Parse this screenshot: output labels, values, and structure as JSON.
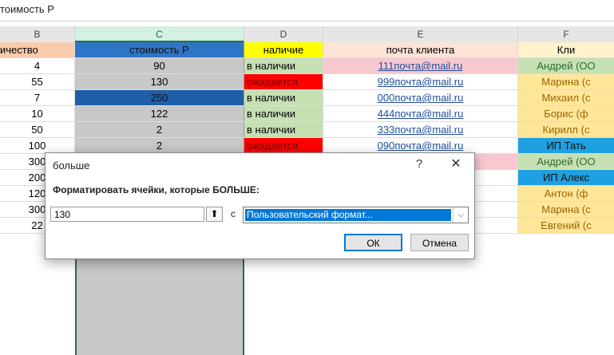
{
  "formula_bar": {
    "text": "тоимость Р"
  },
  "columns": {
    "b": "B",
    "c": "C",
    "d": "D",
    "e": "E",
    "f": "F"
  },
  "header_row": {
    "b": "ичество",
    "c": "стоимость Р",
    "d": "наличие",
    "e": "почта клиента",
    "f": "Кли"
  },
  "rows": [
    {
      "b": "4",
      "c": "90",
      "d": "в наличии",
      "e": "111почта@mail.ru",
      "f": "Андрей (ОО"
    },
    {
      "b": "55",
      "c": "130",
      "d": "ожидается",
      "e": "999почта@mail.ru",
      "f": "Марина (с"
    },
    {
      "b": "7",
      "c": "250",
      "d": "в наличии",
      "e": "000почта@mail.ru",
      "f": "Михаил (с"
    },
    {
      "b": "10",
      "c": "122",
      "d": "в наличии",
      "e": "444почта@mail.ru",
      "f": "Борис (ф"
    },
    {
      "b": "50",
      "c": "2",
      "d": "в наличии",
      "e": "333почта@mail.ru",
      "f": "Кирилл (с"
    },
    {
      "b": "100",
      "c": "2",
      "d": "ожидается",
      "e": "090почта@mail.ru",
      "f": "ИП Тать"
    },
    {
      "b": "300",
      "c": "",
      "d": "",
      "e": "",
      "f": "Андрей (ОО"
    },
    {
      "b": "200",
      "c": "",
      "d": "",
      "e": "",
      "f": "ИП Алекс"
    },
    {
      "b": "120",
      "c": "",
      "d": "",
      "e": "",
      "f": "Антон (ф"
    },
    {
      "b": "300",
      "c": "",
      "d": "",
      "e": "",
      "f": "Марина (с"
    },
    {
      "b": "22",
      "c": "",
      "d": "",
      "e": "",
      "f": "Евгений (с"
    }
  ],
  "dialog": {
    "title": "больше",
    "help": "?",
    "close": "✕",
    "label": "Форматировать ячейки, которые БОЛЬШЕ:",
    "value": "130",
    "collapse_icon": "⬆",
    "with_label": "с",
    "format_selected": "Пользовательский формат...",
    "dropdown_arrow": "⌵",
    "ok": "ОК",
    "cancel": "Отмена"
  },
  "colors": {
    "header_b": "#f8cbad",
    "header_c": "#2f75c5",
    "header_d": "#ffff00",
    "header_e": "#fce4d6",
    "header_f": "#fff2cc",
    "in_stock": "#c6e0b4",
    "awaiting": "#ff0000",
    "email_pink": "#f8c8d0",
    "selected_dark": "#1f5fa8",
    "f_green": "#c6e0b4",
    "f_yellow": "#ffe699",
    "f_blue": "#1fa0e0"
  }
}
